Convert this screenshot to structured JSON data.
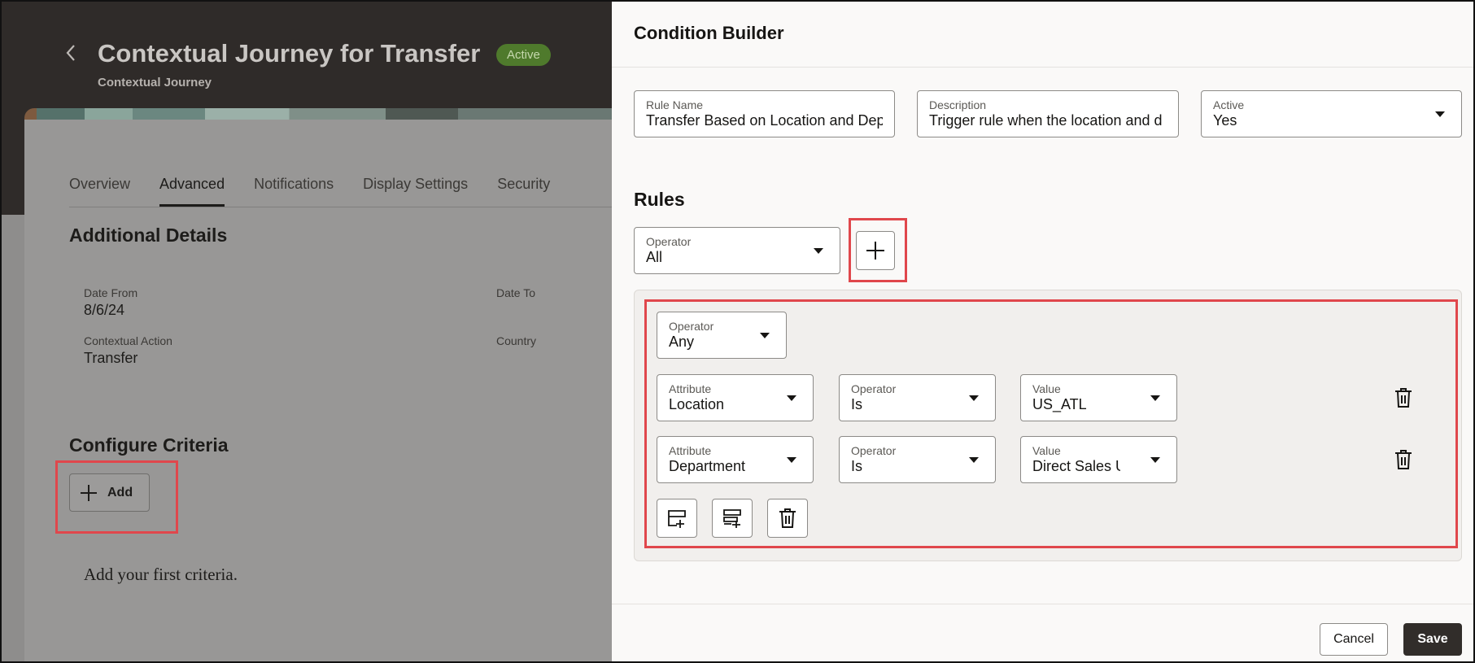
{
  "page": {
    "title": "Contextual Journey for Transfer",
    "status": "Active",
    "subtitle": "Contextual Journey",
    "tabs": [
      {
        "label": "Overview"
      },
      {
        "label": "Advanced"
      },
      {
        "label": "Notifications"
      },
      {
        "label": "Display Settings"
      },
      {
        "label": "Security"
      }
    ],
    "active_tab": "Advanced",
    "additional_details": {
      "title": "Additional Details",
      "date_from_label": "Date From",
      "date_from_value": "8/6/24",
      "date_to_label": "Date To",
      "contextual_action_label": "Contextual Action",
      "contextual_action_value": "Transfer",
      "country_label": "Country"
    },
    "configure_criteria": {
      "title": "Configure Criteria",
      "add_label": "Add",
      "empty_message": "Add your first criteria."
    }
  },
  "drawer": {
    "title": "Condition Builder",
    "rule_name": {
      "label": "Rule Name",
      "value": "Transfer Based on Location and Dep"
    },
    "description": {
      "label": "Description",
      "value": "Trigger rule when the location and d"
    },
    "active": {
      "label": "Active",
      "value": "Yes"
    },
    "rules_title": "Rules",
    "top_operator": {
      "label": "Operator",
      "value": "All"
    },
    "group": {
      "operator": {
        "label": "Operator",
        "value": "Any"
      },
      "conditions": [
        {
          "attribute": {
            "label": "Attribute",
            "value": "Location"
          },
          "operator": {
            "label": "Operator",
            "value": "Is"
          },
          "value": {
            "label": "Value",
            "value": "US_ATL"
          }
        },
        {
          "attribute": {
            "label": "Attribute",
            "value": "Department"
          },
          "operator": {
            "label": "Operator",
            "value": "Is"
          },
          "value": {
            "label": "Value",
            "value": "Direct Sales U"
          }
        }
      ]
    },
    "cancel_label": "Cancel",
    "save_label": "Save"
  },
  "colors": {
    "highlight": "#e0474c",
    "badge": "#4f7a2c",
    "primary_button": "#312d2a"
  }
}
